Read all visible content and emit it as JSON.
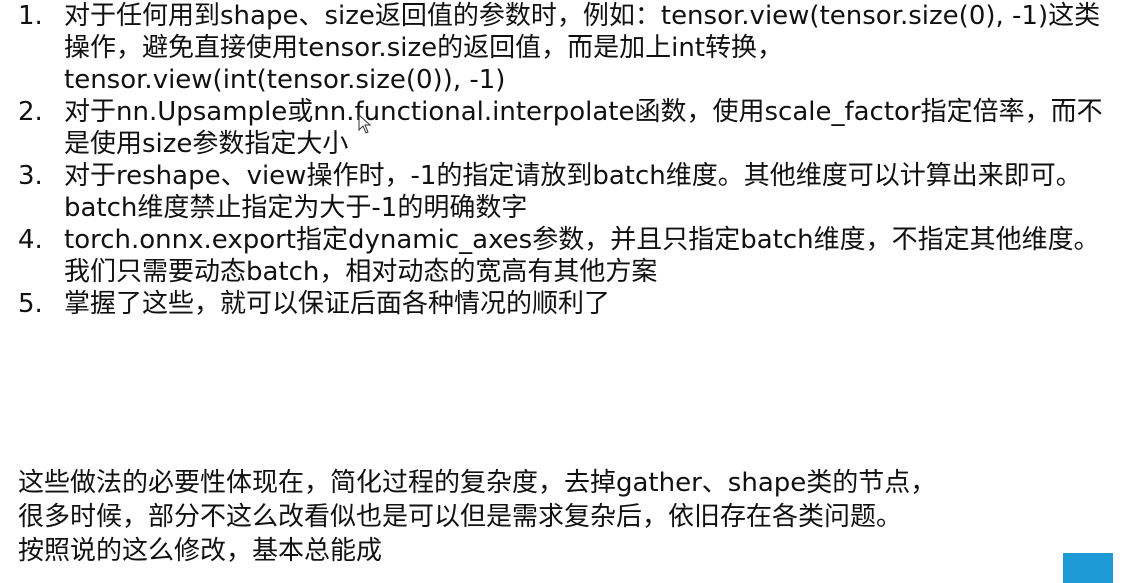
{
  "list": [
    {
      "number": "1.",
      "text": "对于任何用到shape、size返回值的参数时，例如：tensor.view(tensor.size(0), -1)这类操作，避免直接使用tensor.size的返回值，而是加上int转换，tensor.view(int(tensor.size(0)), -1)"
    },
    {
      "number": "2.",
      "text": "对于nn.Upsample或nn.functional.interpolate函数，使用scale_factor指定倍率，而不是使用size参数指定大小"
    },
    {
      "number": "3.",
      "text": "对于reshape、view操作时，-1的指定请放到batch维度。其他维度可以计算出来即可。batch维度禁止指定为大于-1的明确数字"
    },
    {
      "number": "4.",
      "text": "torch.onnx.export指定dynamic_axes参数，并且只指定batch维度，不指定其他维度。我们只需要动态batch，相对动态的宽高有其他方案"
    },
    {
      "number": "5.",
      "text": "掌握了这些，就可以保证后面各种情况的顺利了"
    }
  ],
  "summary": {
    "line1": "这些做法的必要性体现在，简化过程的复杂度，去掉gather、shape类的节点，",
    "line2": "很多时候，部分不这么改看似也是可以但是需求复杂后，依旧存在各类问题。",
    "line3": "按照说的这么修改，基本总能成"
  },
  "colors": {
    "text": "#111111",
    "background": "#ffffff",
    "corner_accent": "#1e9bd7"
  }
}
